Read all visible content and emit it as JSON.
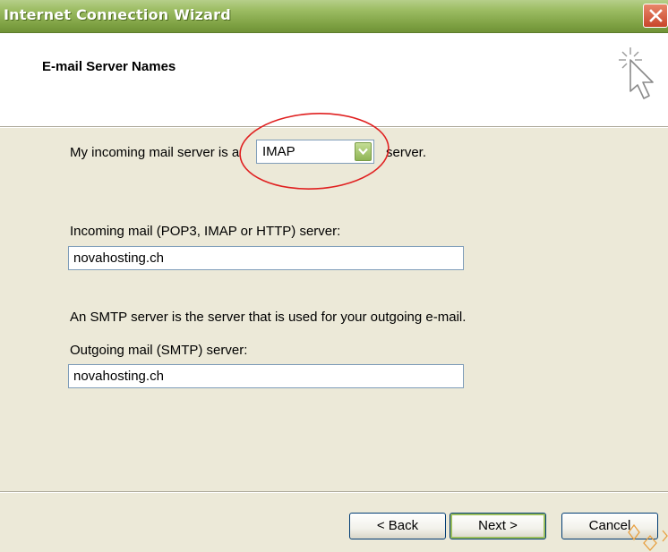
{
  "window": {
    "title": "Internet Connection Wizard"
  },
  "header": {
    "title": "E-mail Server Names"
  },
  "incoming_type": {
    "prefix": "My incoming mail server is a",
    "selected": "IMAP",
    "suffix": "server."
  },
  "incoming_server": {
    "label": "Incoming mail (POP3, IMAP or HTTP) server:",
    "value": "novahosting.ch"
  },
  "smtp_note": "An SMTP server is the server that is used for your outgoing e-mail.",
  "outgoing_server": {
    "label": "Outgoing mail (SMTP) server:",
    "value": "novahosting.ch"
  },
  "buttons": {
    "back": "< Back",
    "next": "Next >",
    "cancel": "Cancel"
  },
  "colors": {
    "titlebar": "#8fb050",
    "dialog_bg": "#ece9d8",
    "annotation": "#e02020",
    "input_border": "#7f9db9"
  },
  "icons": [
    "close-icon",
    "wizard-cursor-icon",
    "dropdown-arrow-icon"
  ]
}
